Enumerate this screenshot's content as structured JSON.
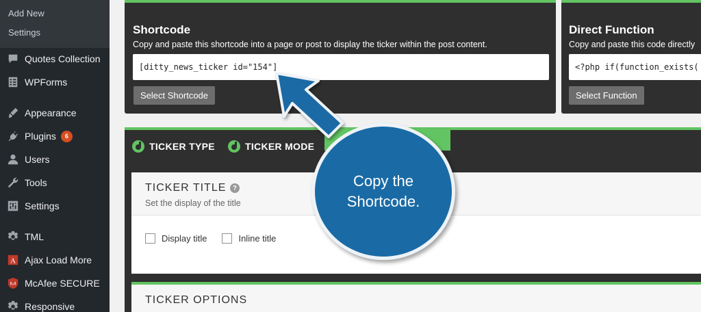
{
  "sidebar": {
    "submenu": [
      "Add New",
      "Settings"
    ],
    "items": [
      {
        "label": "Quotes Collection",
        "icon": "quote-icon"
      },
      {
        "label": "WPForms",
        "icon": "form-icon"
      },
      {
        "label": "Appearance",
        "icon": "brush-icon"
      },
      {
        "label": "Plugins",
        "icon": "plugin-icon",
        "badge": "6"
      },
      {
        "label": "Users",
        "icon": "user-icon"
      },
      {
        "label": "Tools",
        "icon": "wrench-icon"
      },
      {
        "label": "Settings",
        "icon": "settings-icon"
      },
      {
        "label": "TML",
        "icon": "gear-icon"
      },
      {
        "label": "Ajax Load More",
        "icon": "ajax-icon"
      },
      {
        "label": "McAfee SECURE",
        "icon": "shield-icon"
      },
      {
        "label": "Responsive",
        "icon": "gear-icon"
      }
    ]
  },
  "shortcode": {
    "title": "Shortcode",
    "description": "Copy and paste this shortcode into a page or post to display the ticker within the post content.",
    "code": "[ditty_news_ticker id=\"154\"]",
    "button": "Select Shortcode"
  },
  "direct_function": {
    "title": "Direct Function",
    "description": "Copy and paste this code directly",
    "code": "<?php if(function_exists(",
    "button": "Select Function"
  },
  "tabs": [
    {
      "label": "TICKER TYPE"
    },
    {
      "label": "TICKER MODE"
    }
  ],
  "ticker_title": {
    "title": "TICKER TITLE",
    "subtitle": "Set the display of the title",
    "options": [
      "Display title",
      "Inline title"
    ]
  },
  "ticker_options": {
    "title": "TICKER OPTIONS"
  },
  "callout": {
    "line1": "Copy the",
    "line2": "Shortcode."
  },
  "colors": {
    "accent_green": "#62c462",
    "callout_blue": "#1a6ba5",
    "panel_dark": "#2f2f2f",
    "sidebar": "#23282d"
  }
}
